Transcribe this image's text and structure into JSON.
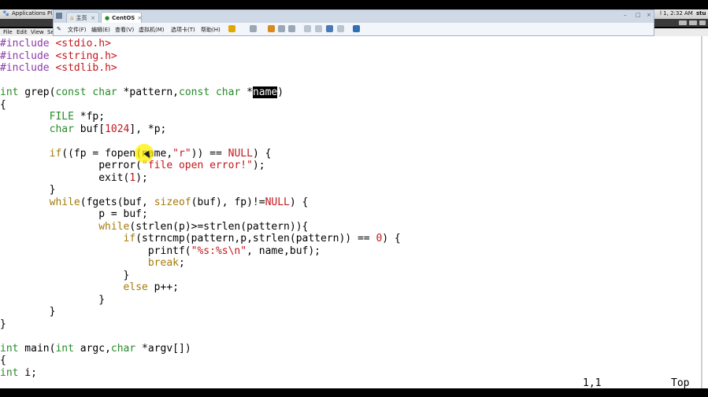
{
  "top_panel": {
    "applications": "Applications",
    "places": "Pl",
    "clock": "l 1, 2:32 AM",
    "user": "stu"
  },
  "gvim_menu": [
    "File",
    "Edit",
    "View",
    "Se"
  ],
  "vmware": {
    "tabs": [
      {
        "label": "主页",
        "icon": "home-icon"
      },
      {
        "label": "CentOS",
        "icon": "vm-icon"
      }
    ],
    "menu": [
      "文件(F)",
      "编辑(E)",
      "查看(V)",
      "虚拟机(M)",
      "选项卡(T)",
      "帮助(H)"
    ]
  },
  "editor": {
    "lines": [
      [
        {
          "t": "#include ",
          "c": "pp"
        },
        {
          "t": "<stdio.h>",
          "c": "str"
        }
      ],
      [
        {
          "t": "#include ",
          "c": "pp"
        },
        {
          "t": "<string.h>",
          "c": "str"
        }
      ],
      [
        {
          "t": "#include ",
          "c": "pp"
        },
        {
          "t": "<stdlib.h>",
          "c": "str"
        }
      ],
      [],
      [
        {
          "t": "int",
          "c": "ty"
        },
        {
          "t": " grep("
        },
        {
          "t": "const char",
          "c": "ty"
        },
        {
          "t": " *pattern,"
        },
        {
          "t": "const char",
          "c": "ty"
        },
        {
          "t": " *"
        },
        {
          "t": "name",
          "c": "sel"
        },
        {
          "t": ")"
        }
      ],
      [
        {
          "t": "{"
        }
      ],
      [
        {
          "t": "        "
        },
        {
          "t": "FILE",
          "c": "ty"
        },
        {
          "t": " *fp;"
        }
      ],
      [
        {
          "t": "        "
        },
        {
          "t": "char",
          "c": "ty"
        },
        {
          "t": " buf["
        },
        {
          "t": "1024",
          "c": "num"
        },
        {
          "t": "], *p;"
        }
      ],
      [],
      [
        {
          "t": "        "
        },
        {
          "t": "if",
          "c": "kw"
        },
        {
          "t": "((fp = fopen(name,"
        },
        {
          "t": "\"r\"",
          "c": "str"
        },
        {
          "t": ")) == "
        },
        {
          "t": "NULL",
          "c": "num"
        },
        {
          "t": ") {"
        }
      ],
      [
        {
          "t": "                perror("
        },
        {
          "t": "\"file open error!\"",
          "c": "str"
        },
        {
          "t": ");"
        }
      ],
      [
        {
          "t": "                exit("
        },
        {
          "t": "1",
          "c": "num"
        },
        {
          "t": ");"
        }
      ],
      [
        {
          "t": "        }"
        }
      ],
      [
        {
          "t": "        "
        },
        {
          "t": "while",
          "c": "kw"
        },
        {
          "t": "(fgets(buf, "
        },
        {
          "t": "sizeof",
          "c": "kw"
        },
        {
          "t": "(buf), fp)!="
        },
        {
          "t": "NULL",
          "c": "num"
        },
        {
          "t": ") {"
        }
      ],
      [
        {
          "t": "                p = buf;"
        }
      ],
      [
        {
          "t": "                "
        },
        {
          "t": "while",
          "c": "kw"
        },
        {
          "t": "(strlen(p)>=strlen(pattern)){"
        }
      ],
      [
        {
          "t": "                    "
        },
        {
          "t": "if",
          "c": "kw"
        },
        {
          "t": "(strncmp(pattern,p,strlen(pattern)) == "
        },
        {
          "t": "0",
          "c": "num"
        },
        {
          "t": ") {"
        }
      ],
      [
        {
          "t": "                        printf("
        },
        {
          "t": "\"%s:%s\\n\"",
          "c": "str"
        },
        {
          "t": ", name,buf);"
        }
      ],
      [
        {
          "t": "                        "
        },
        {
          "t": "break",
          "c": "kw"
        },
        {
          "t": ";"
        }
      ],
      [
        {
          "t": "                    }"
        }
      ],
      [
        {
          "t": "                    "
        },
        {
          "t": "else",
          "c": "kw"
        },
        {
          "t": " p++;"
        }
      ],
      [
        {
          "t": "                }"
        }
      ],
      [
        {
          "t": "        }"
        }
      ],
      [
        {
          "t": "}"
        }
      ],
      [],
      [
        {
          "t": "int",
          "c": "ty"
        },
        {
          "t": " main("
        },
        {
          "t": "int",
          "c": "ty"
        },
        {
          "t": " argc,"
        },
        {
          "t": "char",
          "c": "ty"
        },
        {
          "t": " *argv[])"
        }
      ],
      [
        {
          "t": "{"
        }
      ],
      [
        {
          "t": "int",
          "c": "ty"
        },
        {
          "t": " i;"
        }
      ]
    ],
    "ruler": "1,1",
    "position": "Top"
  }
}
